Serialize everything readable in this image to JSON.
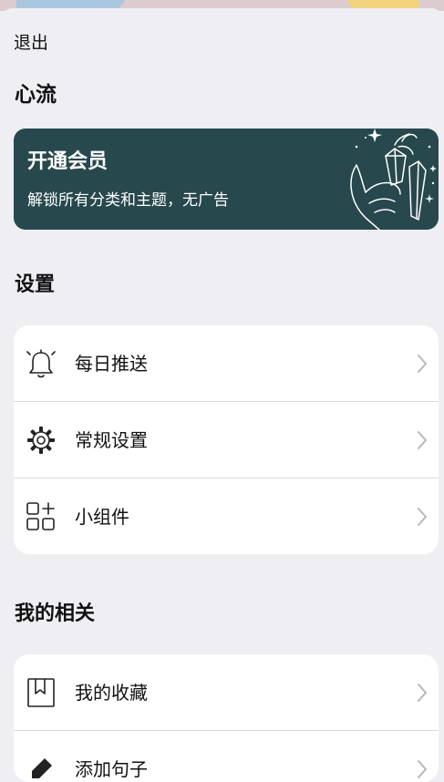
{
  "header": {
    "exit_label": "退出",
    "app_name": "心流"
  },
  "vip": {
    "title": "开通会员",
    "subtitle": "解锁所有分类和主题，无广告",
    "bg_color": "#27484d",
    "art_icon": "hand-crystal-illustration"
  },
  "settings": {
    "title": "设置",
    "items": [
      {
        "label": "每日推送",
        "icon": "bell-icon"
      },
      {
        "label": "常规设置",
        "icon": "gear-icon"
      },
      {
        "label": "小组件",
        "icon": "widgets-icon"
      }
    ]
  },
  "mine": {
    "title": "我的相关",
    "items": [
      {
        "label": "我的收藏",
        "icon": "bookmark-icon"
      },
      {
        "label": "添加句子",
        "icon": "pen-icon"
      }
    ]
  },
  "colors": {
    "background": "#efeef3",
    "card": "#ffffff",
    "separator": "#d9d9de",
    "chevron": "#b7b7bc"
  }
}
